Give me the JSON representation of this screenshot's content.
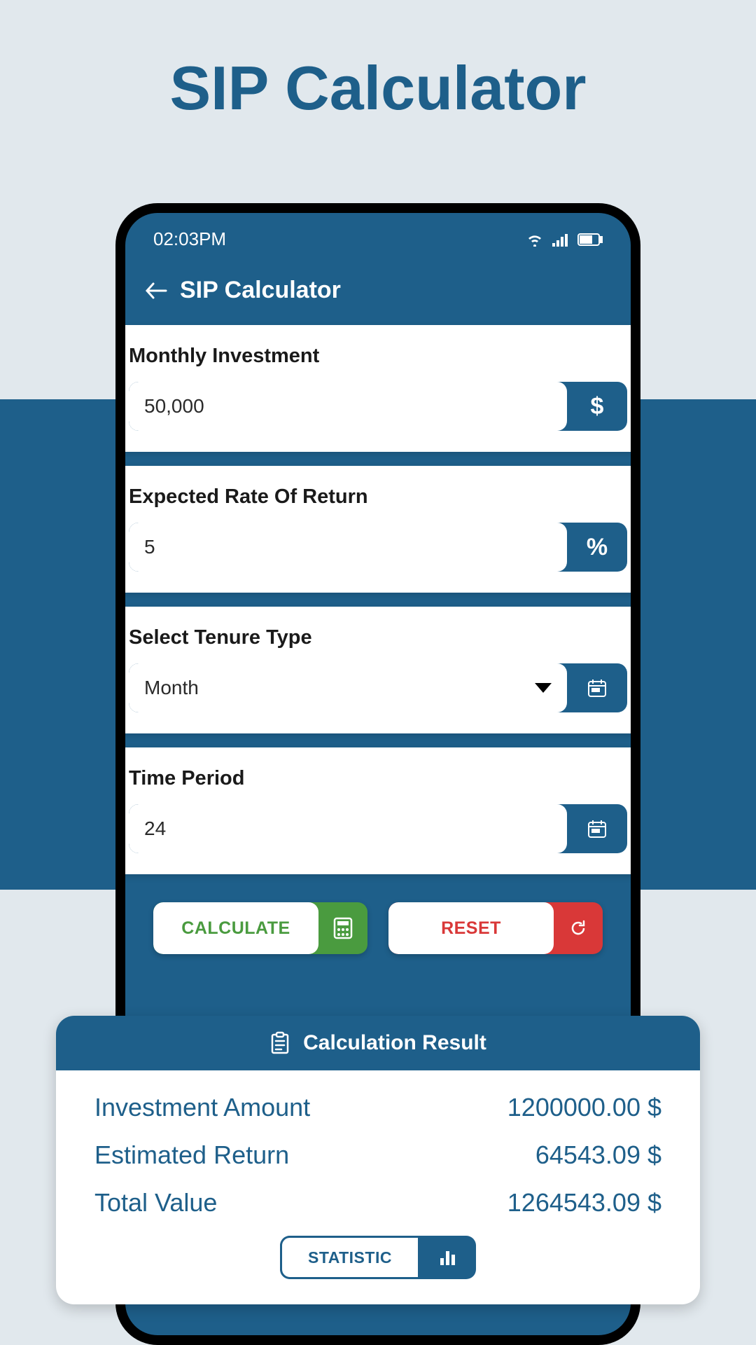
{
  "page_title": "SIP Calculator",
  "status_bar": {
    "time": "02:03PM"
  },
  "app_header": {
    "title": "SIP Calculator"
  },
  "fields": {
    "monthly_investment": {
      "label": "Monthly Investment",
      "value": "50,000",
      "suffix": "$"
    },
    "rate_of_return": {
      "label": "Expected Rate Of Return",
      "value": "5",
      "suffix": "%"
    },
    "tenure_type": {
      "label": "Select Tenure Type",
      "value": "Month"
    },
    "time_period": {
      "label": "Time Period",
      "value": "24"
    }
  },
  "actions": {
    "calculate": "CALCULATE",
    "reset": "RESET"
  },
  "result": {
    "title": "Calculation Result",
    "rows": {
      "investment_amount": {
        "label": "Investment Amount",
        "value": "1200000.00 $"
      },
      "estimated_return": {
        "label": "Estimated Return",
        "value": "64543.09 $"
      },
      "total_value": {
        "label": "Total Value",
        "value": "1264543.09 $"
      }
    },
    "statistic_button": "STATISTIC"
  }
}
